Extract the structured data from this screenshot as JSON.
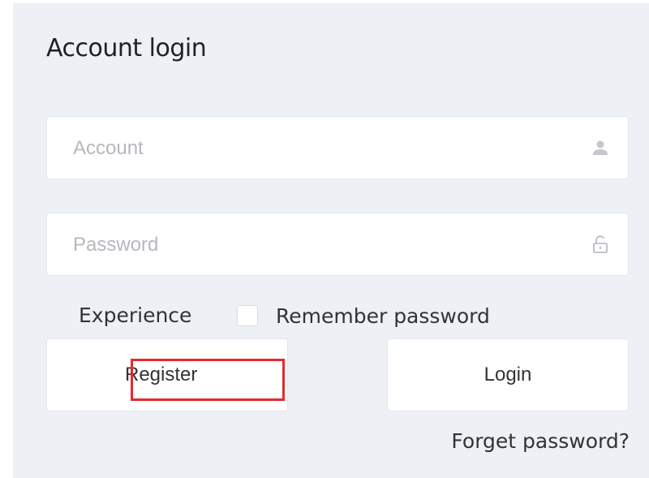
{
  "login": {
    "title": "Account login",
    "account_placeholder": "Account",
    "account_value": "",
    "account_icon": "user-icon",
    "password_placeholder": "Password",
    "password_value": "",
    "password_icon": "unlock-icon",
    "experience_label": "Experience",
    "remember_label": "Remember password",
    "remember_checked": false,
    "register_label": "Register",
    "login_label": "Login",
    "forget_label": "Forget password?"
  },
  "colors": {
    "panel_bg": "#edf0f5",
    "highlight": "#e8282e",
    "placeholder": "#b5b8bd",
    "text": "#333333"
  }
}
